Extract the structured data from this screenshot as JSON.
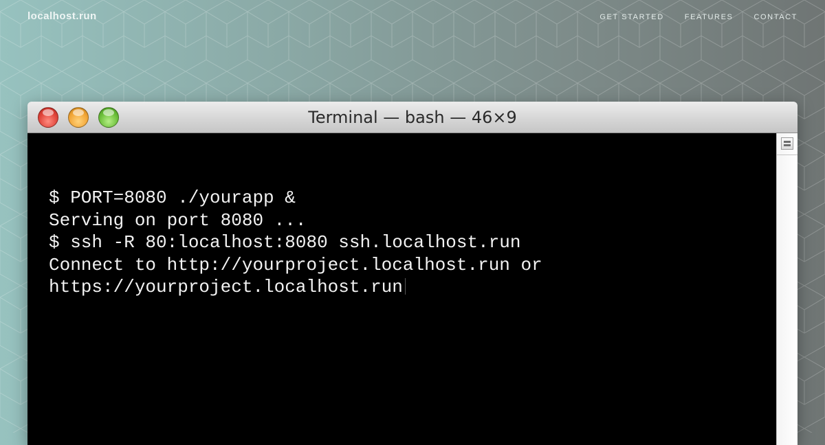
{
  "site": {
    "brand": "localhost.run",
    "nav": [
      "GET STARTED",
      "FEATURES",
      "CONTACT"
    ]
  },
  "terminal": {
    "title": "Terminal — bash — 46×9",
    "lines": [
      "$ PORT=8080 ./yourapp &",
      "Serving on port 8080 ...",
      "$ ssh -R 80:localhost:8080 ssh.localhost.run",
      "Connect to http://yourproject.localhost.run or",
      "https://yourproject.localhost.run"
    ]
  },
  "icons": {
    "close": "close-traffic-light-icon",
    "minimize": "minimize-traffic-light-icon",
    "zoom": "zoom-traffic-light-icon",
    "split": "split-pane-icon"
  },
  "colors": {
    "terminal_bg": "#000000",
    "terminal_text": "#f2f2f2",
    "close": "#e0443a",
    "minimize": "#f2a637",
    "zoom": "#6cbf3a"
  }
}
